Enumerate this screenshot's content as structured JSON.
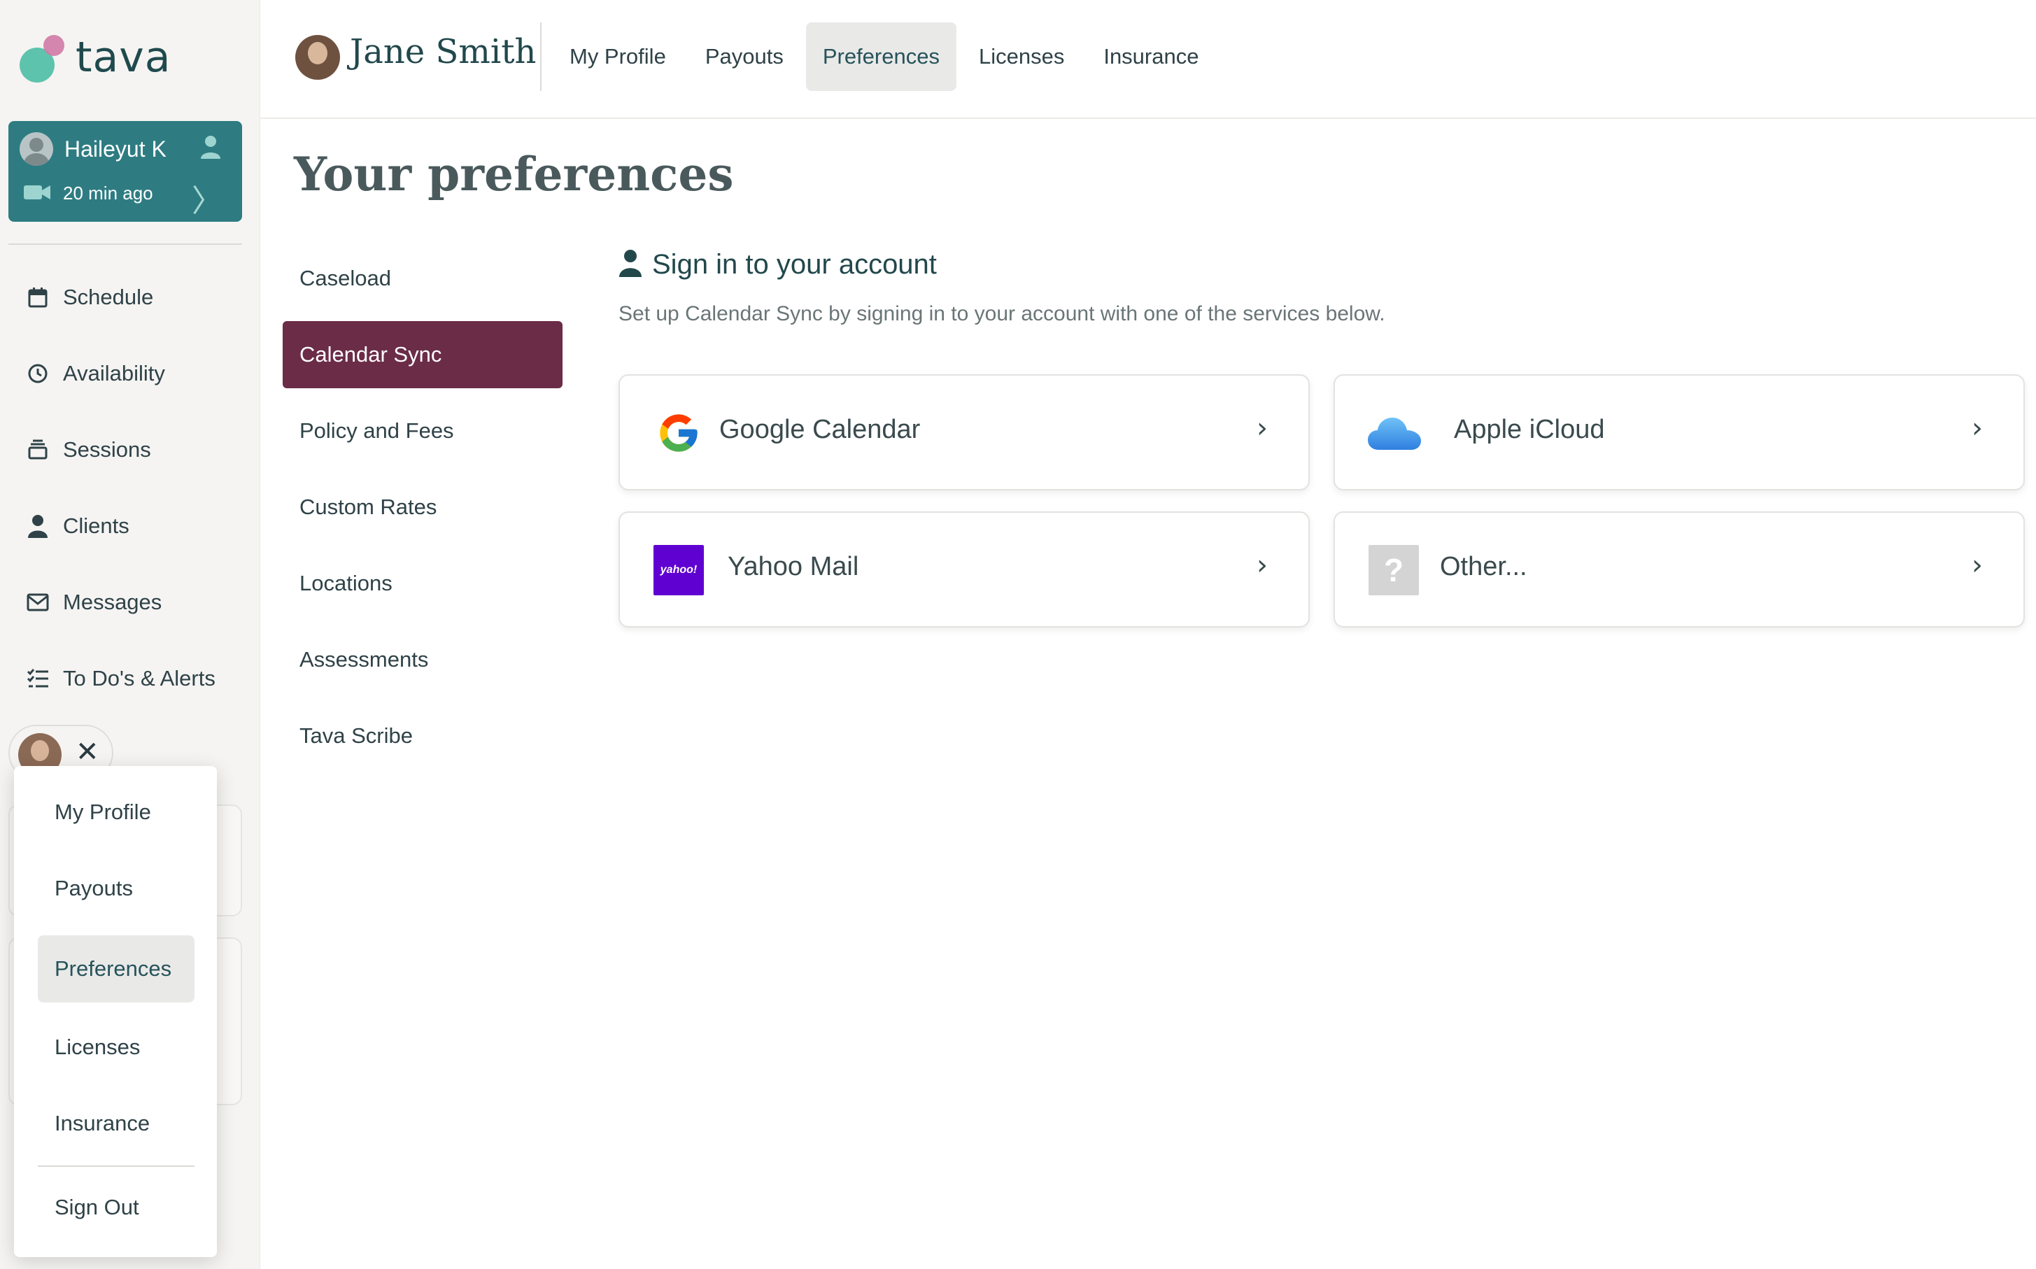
{
  "brand": {
    "name": "tava",
    "colors": {
      "teal": "#2e7c82",
      "plum": "#6b2c48",
      "mint": "#5ec3ad",
      "pink": "#d07aa6"
    }
  },
  "session_card": {
    "name": "Haileyut K",
    "time": "20 min ago"
  },
  "sidebar": {
    "items": [
      {
        "label": "Schedule",
        "icon": "calendar-icon"
      },
      {
        "label": "Availability",
        "icon": "clock-icon"
      },
      {
        "label": "Sessions",
        "icon": "stack-icon"
      },
      {
        "label": "Clients",
        "icon": "person-icon"
      },
      {
        "label": "Messages",
        "icon": "envelope-icon"
      },
      {
        "label": "To Do's & Alerts",
        "icon": "checklist-icon"
      }
    ]
  },
  "profile_menu": {
    "items": [
      {
        "label": "My Profile"
      },
      {
        "label": "Payouts"
      },
      {
        "label": "Preferences",
        "active": true
      },
      {
        "label": "Licenses"
      },
      {
        "label": "Insurance"
      }
    ],
    "sign_out": "Sign Out"
  },
  "header": {
    "user_name": "Jane Smith",
    "tabs": [
      {
        "label": "My Profile"
      },
      {
        "label": "Payouts"
      },
      {
        "label": "Preferences",
        "active": true
      },
      {
        "label": "Licenses"
      },
      {
        "label": "Insurance"
      }
    ]
  },
  "main": {
    "title": "Your preferences",
    "pref_nav": [
      {
        "label": "Caseload"
      },
      {
        "label": "Calendar Sync",
        "active": true
      },
      {
        "label": "Policy and Fees"
      },
      {
        "label": "Custom Rates"
      },
      {
        "label": "Locations"
      },
      {
        "label": "Assessments"
      },
      {
        "label": "Tava Scribe"
      }
    ],
    "section_title": "Sign in to your account",
    "section_subtitle": "Set up Calendar Sync by signing in to your account with one of the services below.",
    "services": [
      {
        "label": "Google Calendar",
        "icon": "google-icon"
      },
      {
        "label": "Apple iCloud",
        "icon": "icloud-icon"
      },
      {
        "label": "Yahoo Mail",
        "icon": "yahoo-icon",
        "logo_text": "yahoo!"
      },
      {
        "label": "Other...",
        "icon": "question-icon",
        "logo_text": "?"
      }
    ]
  }
}
